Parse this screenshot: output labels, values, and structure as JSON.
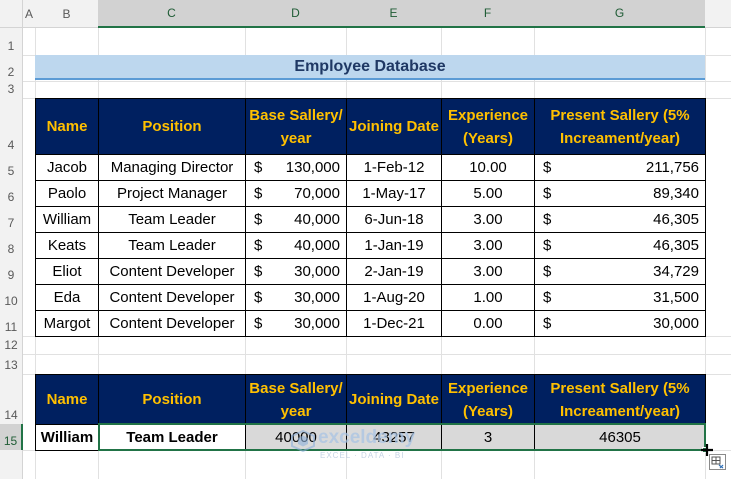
{
  "columns": [
    "A",
    "B",
    "C",
    "D",
    "E",
    "F",
    "G"
  ],
  "rows": [
    "1",
    "2",
    "3",
    "4",
    "5",
    "6",
    "7",
    "8",
    "9",
    "10",
    "11",
    "12",
    "13",
    "14",
    "15"
  ],
  "title": "Employee Database",
  "headers": {
    "name": "Name",
    "position": "Position",
    "base_salary": "Base Sallery/ year",
    "joining_date": "Joining Date",
    "experience": "Experience (Years)",
    "present_salary": "Present Sallery (5% Increament/year)"
  },
  "currency_symbol": "$",
  "employees": [
    {
      "name": "Jacob",
      "position": "Managing Director",
      "base": "130,000",
      "date": "1-Feb-12",
      "exp": "10.00",
      "present": "211,756"
    },
    {
      "name": "Paolo",
      "position": "Project Manager",
      "base": "70,000",
      "date": "1-May-17",
      "exp": "5.00",
      "present": "89,340"
    },
    {
      "name": "William",
      "position": "Team Leader",
      "base": "40,000",
      "date": "6-Jun-18",
      "exp": "3.00",
      "present": "46,305"
    },
    {
      "name": "Keats",
      "position": "Team Leader",
      "base": "40,000",
      "date": "1-Jan-19",
      "exp": "3.00",
      "present": "46,305"
    },
    {
      "name": "Eliot",
      "position": "Content Developer",
      "base": "30,000",
      "date": "2-Jan-19",
      "exp": "3.00",
      "present": "34,729"
    },
    {
      "name": "Eda",
      "position": "Content Developer",
      "base": "30,000",
      "date": "1-Aug-20",
      "exp": "1.00",
      "present": "31,500"
    },
    {
      "name": "Margot",
      "position": "Content Developer",
      "base": "30,000",
      "date": "1-Dec-21",
      "exp": "0.00",
      "present": "30,000"
    }
  ],
  "result": {
    "name": "William",
    "position": "Team Leader",
    "base": "40000",
    "date": "43257",
    "exp": "3",
    "present": "46305"
  },
  "watermark": {
    "brand": "exceldemy",
    "tagline": "EXCEL · DATA · BI"
  },
  "colors": {
    "header_bg": "#002060",
    "header_text": "#ffc000",
    "title_bg": "#bdd7ee",
    "selection": "#217346"
  }
}
